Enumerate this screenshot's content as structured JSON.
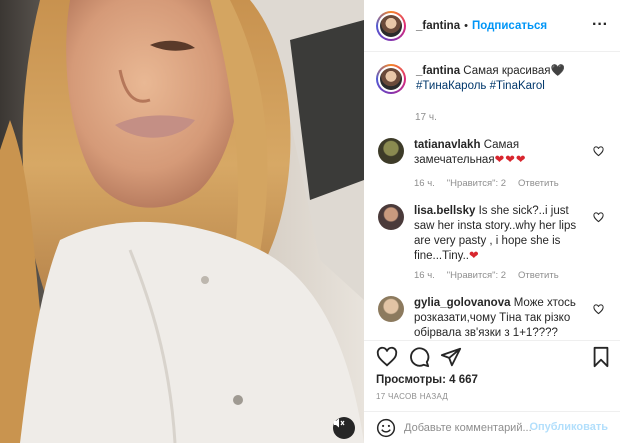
{
  "post": {
    "username": "_fantina",
    "follow_label": "Подписаться",
    "header_dot": "•",
    "more_label": "···",
    "caption": {
      "username": "_fantina",
      "text": "Самая красивая",
      "emoji": "🖤",
      "hashtag1": "#ТинаКароль",
      "hashtag2": "#TinaKarol",
      "time": "17 ч."
    },
    "comments": [
      {
        "username": "tatianavlakh",
        "text": "Самая замечательная",
        "emoji": "❤❤❤",
        "time": "16 ч.",
        "likes": "\"Нравится\": 2",
        "reply": "Ответить",
        "avatar_color": "#3d3b28"
      },
      {
        "username": "lisa.bellsky",
        "text": "Is she sick?..i just saw her insta story..why her lips are very pasty , i hope she is fine...Tiny..",
        "emoji": "❤",
        "time": "16 ч.",
        "likes": "\"Нравится\": 2",
        "reply": "Ответить",
        "avatar_color": "#4a3a3a"
      },
      {
        "username": "gylia_golovanova",
        "text": "Може хтось розказати,чому Тіна так різко обірвала зв'язки з 1+1????",
        "emoji": "",
        "time": "",
        "likes": "",
        "reply": "",
        "avatar_color": "#8c7a5e"
      }
    ],
    "views": "Просмотры: 4 667",
    "posted": "17 ЧАСОВ НАЗАД",
    "comment_placeholder": "Добавьте комментарий...",
    "publish_label": "Опубликовать"
  },
  "icons": {
    "heart": "heart-icon",
    "comment": "comment-icon",
    "share": "share-icon",
    "bookmark": "bookmark-icon",
    "emoji": "emoji-icon",
    "mute": "mute-icon"
  },
  "colors": {
    "accent": "#0095f6",
    "hashtag": "#00376b",
    "muted": "#8e8e8e",
    "heart_red": "#d8262e"
  }
}
